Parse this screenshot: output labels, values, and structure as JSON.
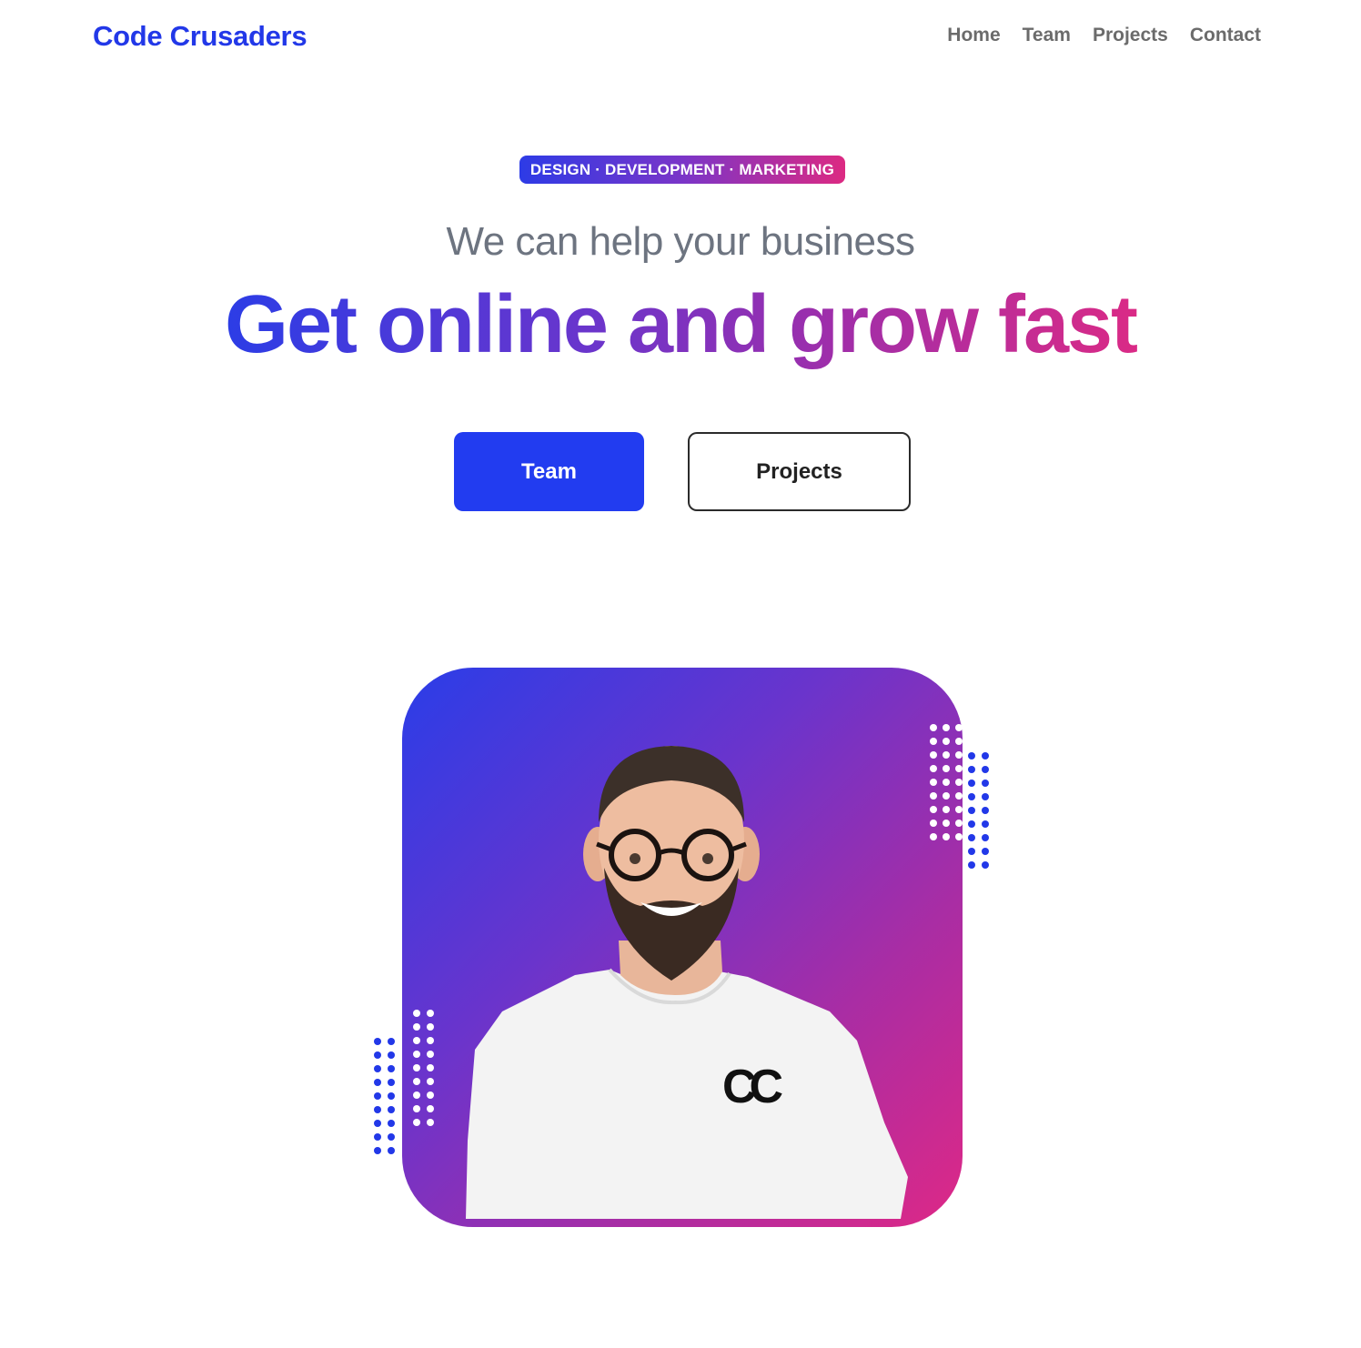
{
  "brand": {
    "name": "Code Crusaders",
    "color": "#2238e8"
  },
  "nav": {
    "items": [
      "Home",
      "Team",
      "Projects",
      "Contact"
    ]
  },
  "hero": {
    "tag": "DESIGN · DEVELOPMENT · MARKETING",
    "subtitle": "We can help your business",
    "headline": "Get online and grow fast",
    "gradient": [
      "#2b3de6",
      "#7a35c8",
      "#dc2a82"
    ]
  },
  "buttons": {
    "primary": "Team",
    "secondary": "Projects",
    "primary_color": "#223cf0"
  },
  "photo": {
    "shirt_logo": "CC"
  }
}
